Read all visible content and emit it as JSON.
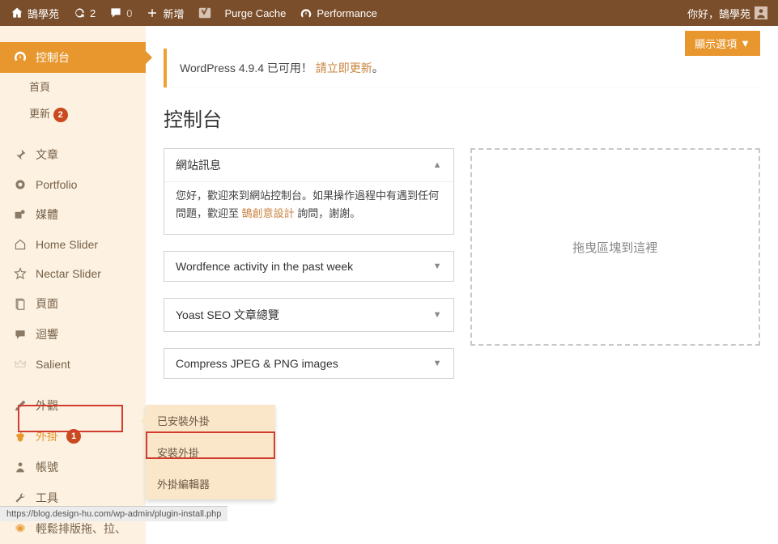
{
  "adminbar": {
    "site_name": "鵠學苑",
    "refresh_count": "2",
    "comments_count": "0",
    "new_label": "新增",
    "purge_label": "Purge Cache",
    "performance_label": "Performance",
    "greeting": "你好，鵠學苑"
  },
  "sidebar": {
    "dashboard": "控制台",
    "home": "首頁",
    "updates": "更新",
    "updates_count": "2",
    "posts": "文章",
    "portfolio": "Portfolio",
    "media": "媒體",
    "home_slider": "Home Slider",
    "nectar_slider": "Nectar Slider",
    "pages": "頁面",
    "comments": "迴響",
    "salient": "Salient",
    "appearance": "外觀",
    "plugins": "外掛",
    "plugins_count": "1",
    "users": "帳號",
    "tools": "工具",
    "easy_layout": "輕鬆排版拖、拉、"
  },
  "flyout": {
    "installed": "已安裝外掛",
    "add_new": "安裝外掛",
    "editor": "外掛編輯器"
  },
  "content": {
    "screen_options": "顯示選項",
    "notice_text": "WordPress 4.9.4 已可用！",
    "notice_link": "請立即更新",
    "notice_suffix": "。",
    "title": "控制台",
    "widget1_title": "網站訊息",
    "widget1_body_prefix": "您好，歡迎來到網站控制台。如果操作過程中有遇到任何問題，歡迎至 ",
    "widget1_link": "鵠創意設計",
    "widget1_body_suffix": " 詢問，謝謝。",
    "widget2_title": "Wordfence activity in the past week",
    "widget3_title": "Yoast SEO 文章總覽",
    "widget4_title": "Compress JPEG & PNG images",
    "dropzone": "拖曳區塊到這裡"
  },
  "statusbar": {
    "url": "https://blog.design-hu.com/wp-admin/plugin-install.php"
  }
}
